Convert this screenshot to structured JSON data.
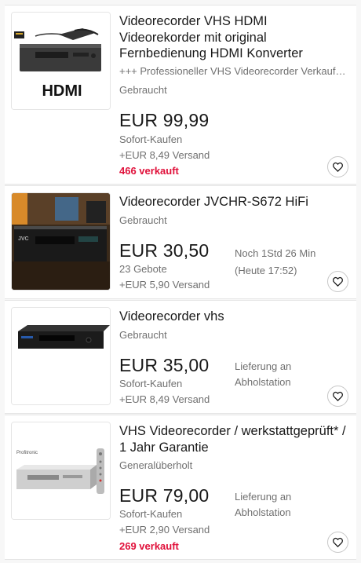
{
  "items": [
    {
      "title": "Videorecorder VHS HDMI Videorekorder mit original Fernbedienung HDMI Konverter",
      "subtitle": "+++ Professioneller VHS Videorecorder Verkauf +++",
      "condition": "Gebraucht",
      "price": "EUR 99,99",
      "buy_type": "Sofort-Kaufen",
      "shipping": "+EUR 8,49 Versand",
      "sold": "466 verkauft",
      "image_icon": "vhs-hdmi-recorder-photo",
      "image_text": "HDMI"
    },
    {
      "title": "Videorecorder JVCHR-S672 HiFi",
      "condition": "Gebraucht",
      "price": "EUR 30,50",
      "bids": "23 Gebote",
      "shipping": "+EUR 5,90 Versand",
      "time_left": "Noch 1Std 26 Min",
      "end_time": "(Heute 17:52)",
      "image_icon": "jvc-recorder-photo",
      "image_text": "JVC"
    },
    {
      "title": "Videorecorder vhs",
      "condition": "Gebraucht",
      "price": "EUR 35,00",
      "buy_type": "Sofort-Kaufen",
      "shipping": "+EUR 8,49 Versand",
      "delivery_line1": "Lieferung an",
      "delivery_line2": "Abholstation",
      "image_icon": "black-vhs-recorder-photo"
    },
    {
      "title": "VHS Videorecorder / werkstattgeprüft* / 1 Jahr Garantie",
      "condition": "Generalüberholt",
      "price": "EUR 79,00",
      "buy_type": "Sofort-Kaufen",
      "shipping": "+EUR 2,90 Versand",
      "sold": "269 verkauft",
      "delivery_line1": "Lieferung an",
      "delivery_line2": "Abholstation",
      "image_icon": "silver-vhs-recorder-photo",
      "image_text": "Profitronic"
    }
  ],
  "colors": {
    "sold": "#e0103a",
    "secondary": "#707070",
    "primary": "#191919"
  }
}
